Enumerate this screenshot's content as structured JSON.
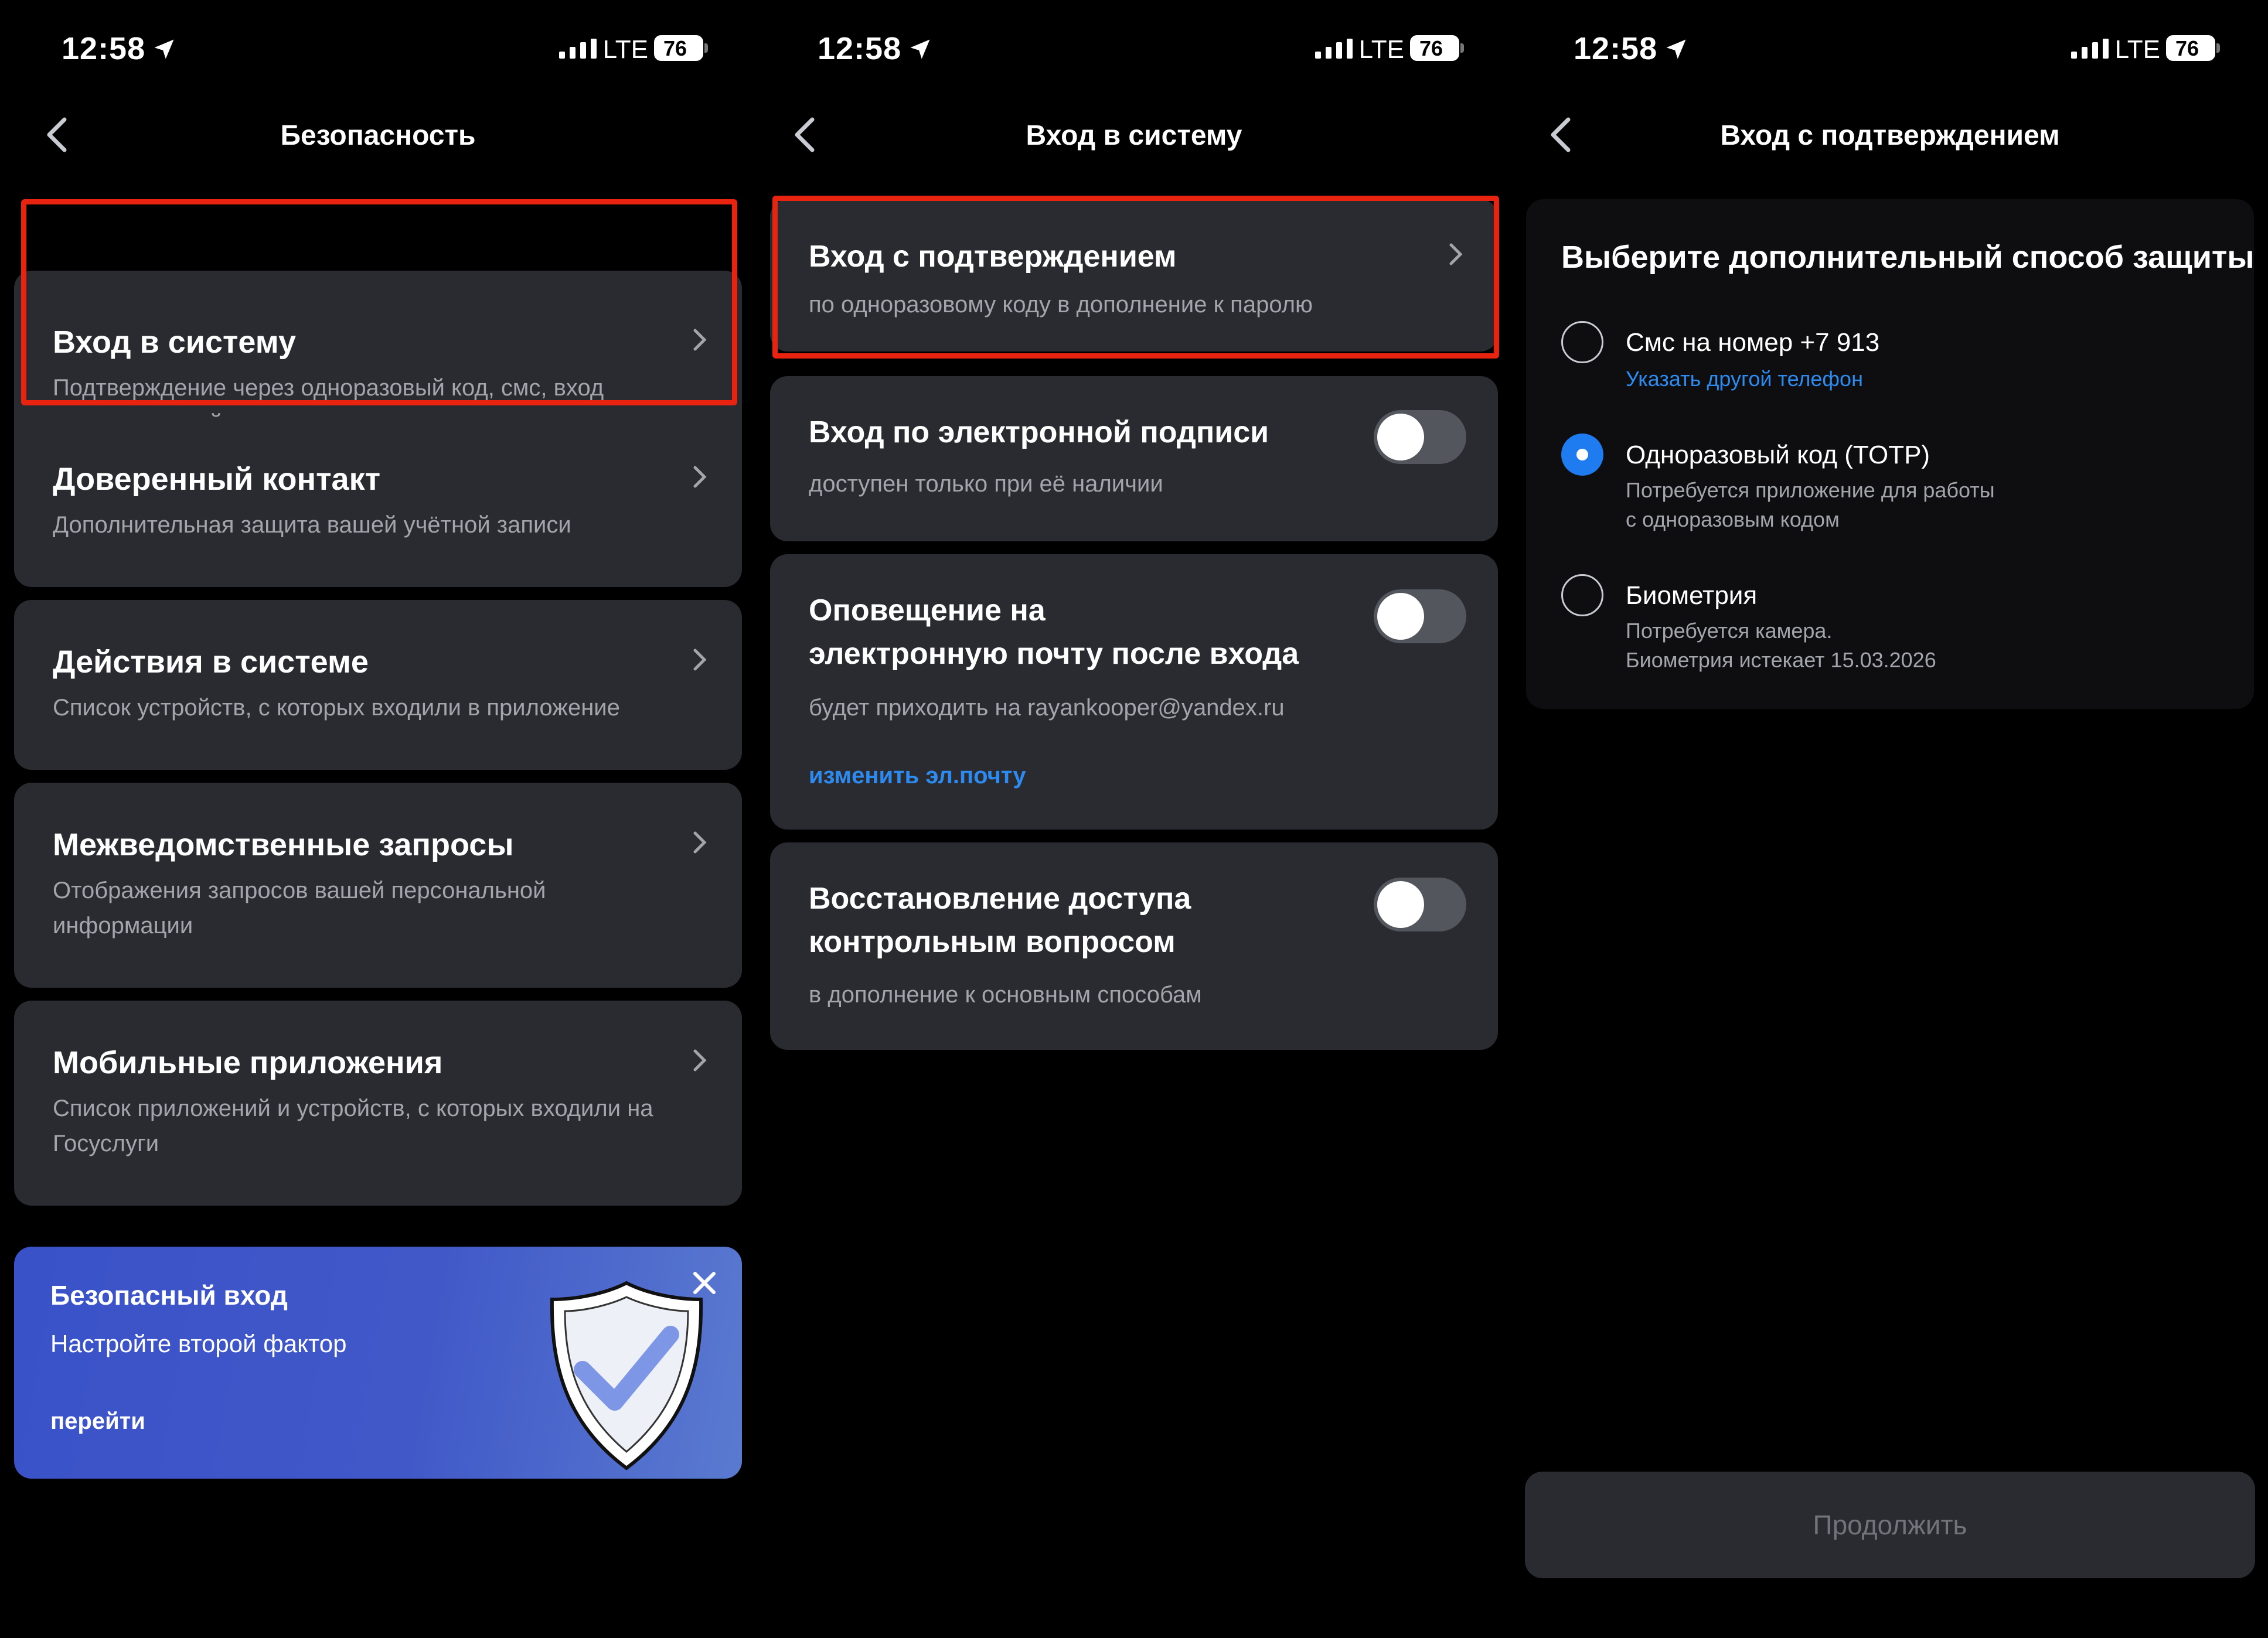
{
  "status_bar": {
    "time": "12:58",
    "network": "LTE",
    "battery": "76"
  },
  "screen1": {
    "title": "Безопасность",
    "items": [
      {
        "title": "Вход в систему",
        "subtitle_line1": "Подтверждение через одноразовый код, смс, вход",
        "subtitle_line2": "по электронной подписи"
      },
      {
        "title": "Доверенный контакт",
        "subtitle_line1": "Дополнительная защита вашей учётной записи"
      },
      {
        "title": "Действия в системе",
        "subtitle_line1": "Список устройств, с которых входили в приложение"
      },
      {
        "title": "Межведомственные запросы",
        "subtitle_line1": "Отображения запросов вашей персональной",
        "subtitle_line2": "информации"
      },
      {
        "title": "Мобильные приложения",
        "subtitle_line1": "Список приложений и устройств, с которых входили на",
        "subtitle_line2": "Госуслуги"
      }
    ],
    "banner": {
      "title": "Безопасный вход",
      "subtitle": "Настройте второй фактор",
      "link": "перейти"
    }
  },
  "screen2": {
    "title": "Вход в систему",
    "items": [
      {
        "title": "Вход с подтверждением",
        "subtitle": "по одноразовому коду в дополнение к паролю"
      },
      {
        "title": "Вход по электронной подписи",
        "subtitle": "доступен только при её наличии",
        "toggle": false
      },
      {
        "title_line1": "Оповещение на",
        "title_line2": "электронную почту после входа",
        "subtitle": "будет приходить на rayankooper@yandex.ru",
        "link": "изменить эл.почту",
        "toggle": false
      },
      {
        "title_line1": "Восстановление доступа",
        "title_line2": "контрольным вопросом",
        "subtitle": "в дополнение к основным способам",
        "toggle": false
      }
    ]
  },
  "screen3": {
    "title": "Вход с подтверждением",
    "prompt": "Выберите дополнительный способ защиты",
    "options": [
      {
        "title": "Смс на номер +7 913",
        "link": "Указать другой телефон",
        "selected": false
      },
      {
        "title": "Одноразовый код (TOTP)",
        "subtitle_line1": "Потребуется приложение для работы",
        "subtitle_line2": "с одноразовым кодом",
        "selected": true
      },
      {
        "title": "Биометрия",
        "subtitle_line1": "Потребуется камера.",
        "subtitle_line2": "Биометрия истекает 15.03.2026",
        "selected": false
      }
    ],
    "continue_button": "Продолжить"
  },
  "colors": {
    "highlight": "#e8230f",
    "accent": "#1e7cf0",
    "card": "#2a2b31"
  }
}
